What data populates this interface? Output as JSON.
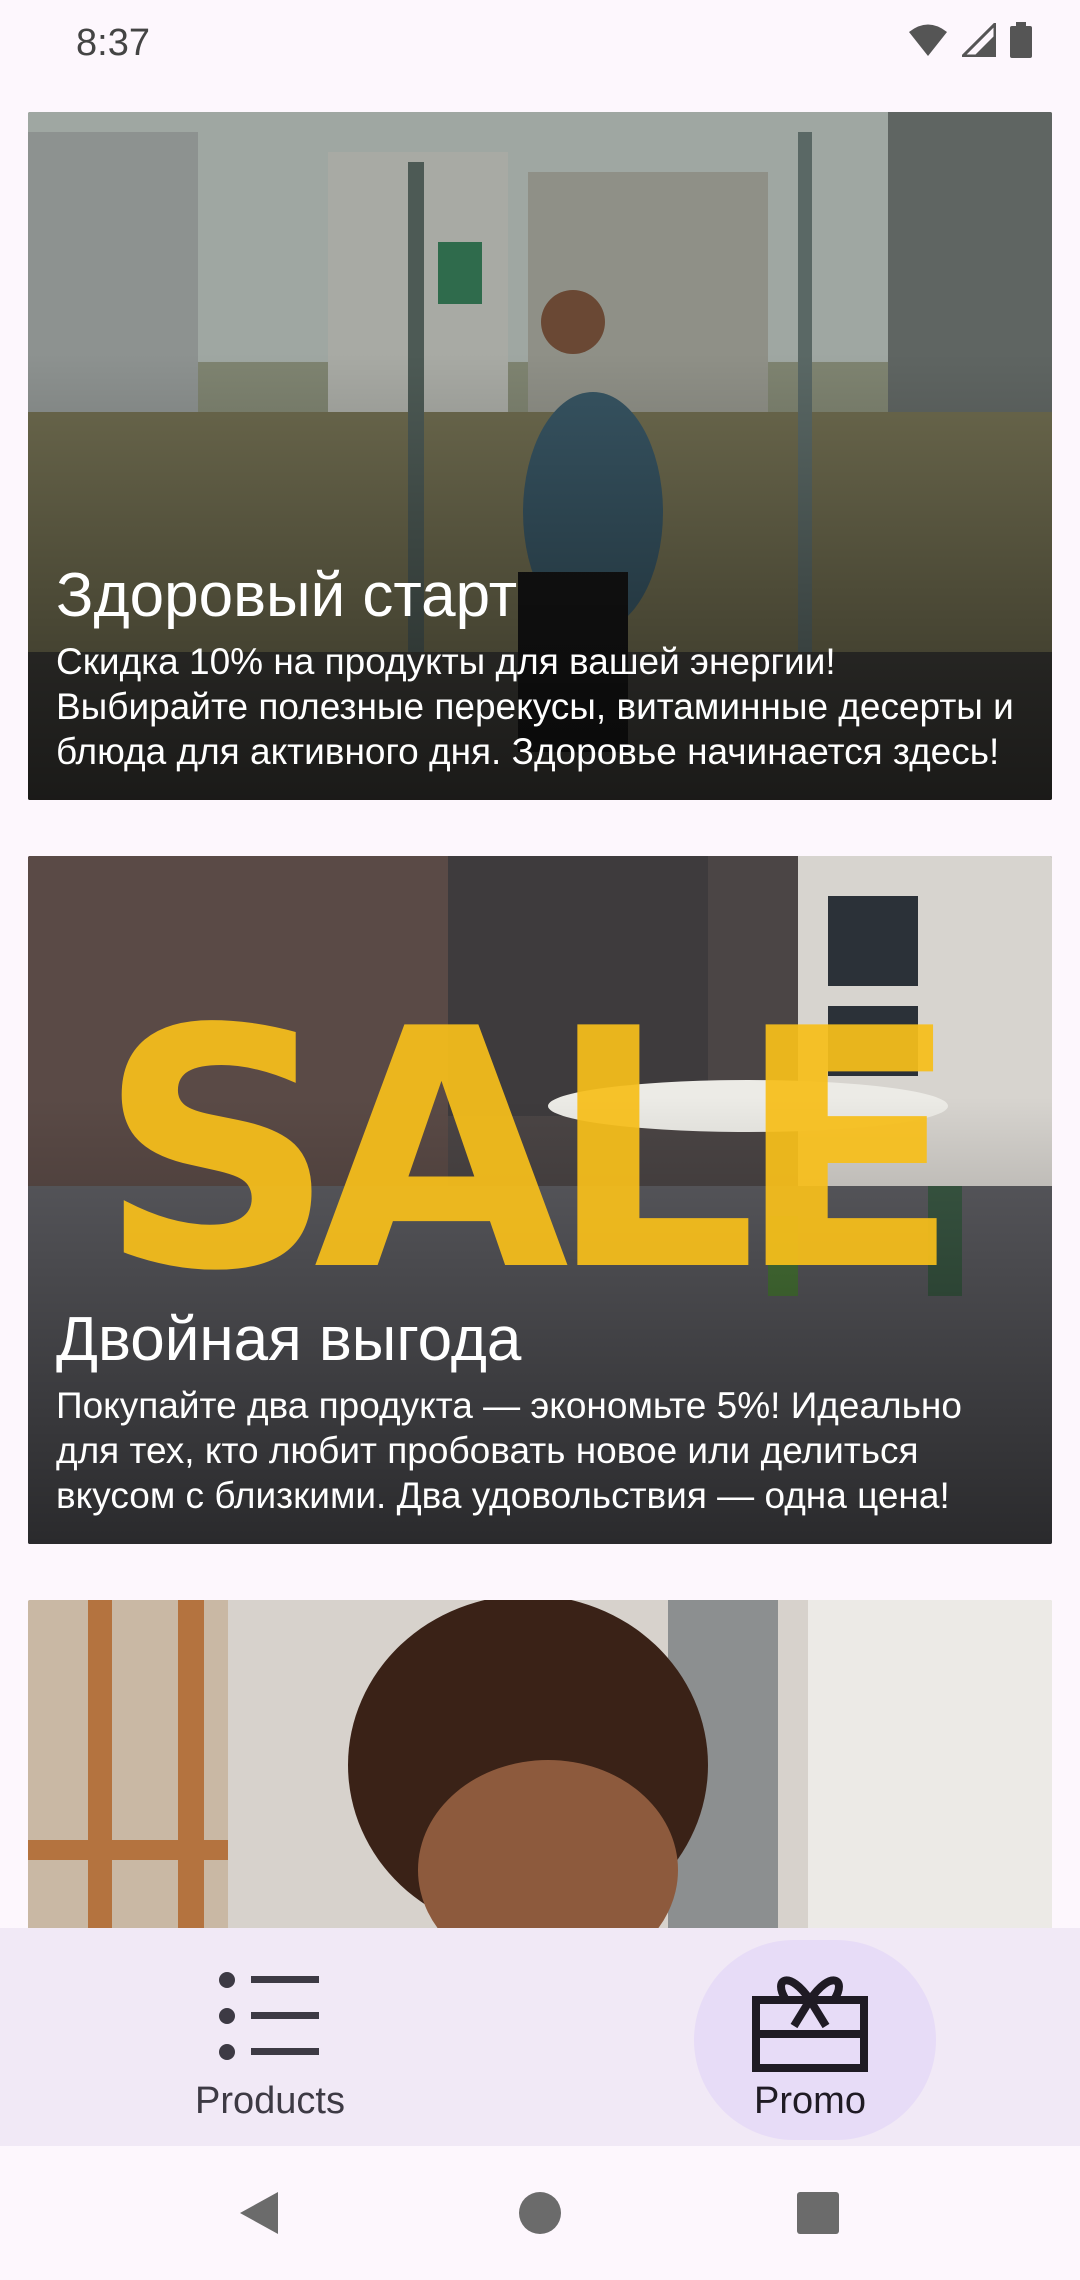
{
  "status_bar": {
    "time": "8:37",
    "icons": [
      "wifi-icon",
      "signal-icon",
      "battery-icon"
    ]
  },
  "promos": [
    {
      "title": "Здоровый старт",
      "description": "Скидка 10% на продукты для вашей энергии! Выбирайте полезные перекусы, витаминные десерты и блюда для активного дня. Здоровье начинается здесь!"
    },
    {
      "title": "Двойная выгода",
      "description": "Покупайте два продукта — экономьте 5%! Идеально для тех, кто любит пробовать новое или делиться вкусом с близкими. Два удовольствия — одна цена!",
      "image_text": "SALE"
    },
    {
      "title": "",
      "description": ""
    }
  ],
  "bottom_nav": {
    "items": [
      {
        "label": "Products",
        "icon": "list-icon",
        "selected": false
      },
      {
        "label": "Promo",
        "icon": "gift-icon",
        "selected": true
      }
    ],
    "indicator_color": "#e7dcf7",
    "background_color": "#f1e9f6"
  },
  "system_nav": {
    "buttons": [
      "back-icon",
      "home-icon",
      "recents-icon"
    ]
  }
}
